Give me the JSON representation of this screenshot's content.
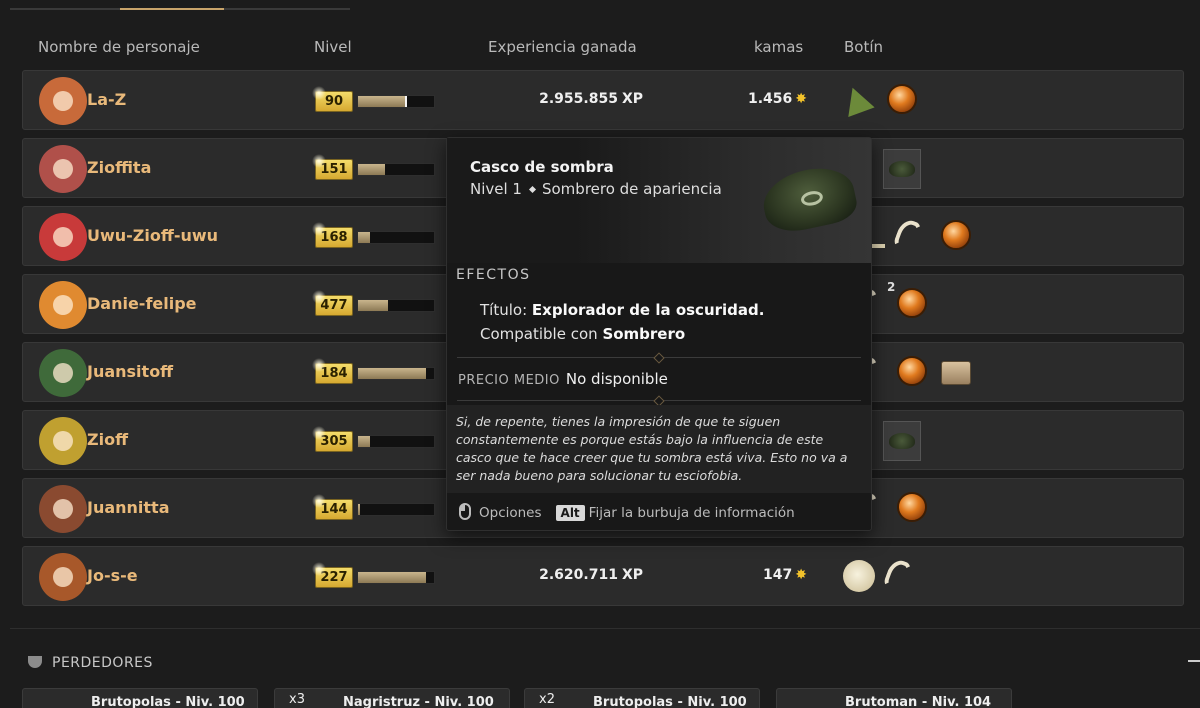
{
  "columns": {
    "name": "Nombre de personaje",
    "level": "Nivel",
    "xp": "Experiencia ganada",
    "kamas": "kamas",
    "loot": "Botín"
  },
  "rows": [
    {
      "name": "La-Z",
      "level": "90",
      "level_progress": 0.62,
      "xp": "2.955.855",
      "kamas": "1.456",
      "avatar_color": "#c86a3a",
      "loot": [
        "triangle-charm-icon",
        "orange-orb-icon"
      ]
    },
    {
      "name": "Zioffita",
      "level": "151",
      "level_progress": 0.36,
      "xp": "",
      "kamas": "",
      "avatar_color": "#b0504a",
      "loot": [
        "dark-hat-icon"
      ]
    },
    {
      "name": "Uwu-Zioff-uwu",
      "level": "168",
      "level_progress": 0.16,
      "xp": "",
      "kamas": "",
      "avatar_color": "#c83a3a",
      "loot": [
        "horn-icon",
        "fang-icon",
        "orange-orb-icon"
      ]
    },
    {
      "name": "Danie-felipe",
      "level": "477",
      "level_progress": 0.4,
      "xp": "",
      "kamas": "",
      "avatar_color": "#e08a30",
      "loot": [
        "fang-icon",
        "orange-orb-icon"
      ]
    },
    {
      "name": "Juansitoff",
      "level": "184",
      "level_progress": 0.9,
      "xp": "",
      "kamas": "",
      "avatar_color": "#3f6a3a",
      "loot": [
        "fang-icon",
        "orange-orb-icon",
        "chest-icon"
      ]
    },
    {
      "name": "Zioff",
      "level": "305",
      "level_progress": 0.16,
      "xp": "",
      "kamas": "",
      "avatar_color": "#c0a030",
      "loot": [
        "dark-hat-icon"
      ]
    },
    {
      "name": "Juannitta",
      "level": "144",
      "level_progress": 0.03,
      "xp": "",
      "kamas": "",
      "avatar_color": "#8a4a30",
      "loot": [
        "fang-icon",
        "orange-orb-icon"
      ]
    },
    {
      "name": "Jo-s-e",
      "level": "227",
      "level_progress": 0.9,
      "xp": "2.620.711",
      "kamas": "147",
      "avatar_color": "#a8582a",
      "loot": [
        "ghost-icon",
        "fang-icon"
      ]
    }
  ],
  "xp_unit": "XP",
  "loot_count": "2",
  "losers": {
    "title": "PERDEDORES",
    "cards": [
      {
        "mult": "",
        "text": "Brutopolas - Niv. 100"
      },
      {
        "mult": "x3",
        "text": "Nagristruz - Niv. 100"
      },
      {
        "mult": "x2",
        "text": "Brutopolas - Niv. 100"
      },
      {
        "mult": "",
        "text": "Brutoman - Niv. 104"
      }
    ]
  },
  "tooltip": {
    "title": "Casco de sombra",
    "level": "Nivel 1",
    "type": "Sombrero de apariencia",
    "effects_label": "EFECTOS",
    "effect_title_prefix": "Título:",
    "effect_title_value": "Explorador de la oscuridad.",
    "compat_prefix": "Compatible con",
    "compat_value": "Sombrero",
    "price_label": "PRECIO MEDIO",
    "price_value": "No disponible",
    "description": "Si, de repente, tienes la impresión de que te siguen constantemente es porque estás bajo la influencia de este casco que te hace creer que tu sombra está viva. Esto no va a ser nada bueno para solucionar tu esciofobia.",
    "options_label": "Opciones",
    "alt_key": "Alt",
    "pin_label": "Fijar la burbuja de información"
  }
}
